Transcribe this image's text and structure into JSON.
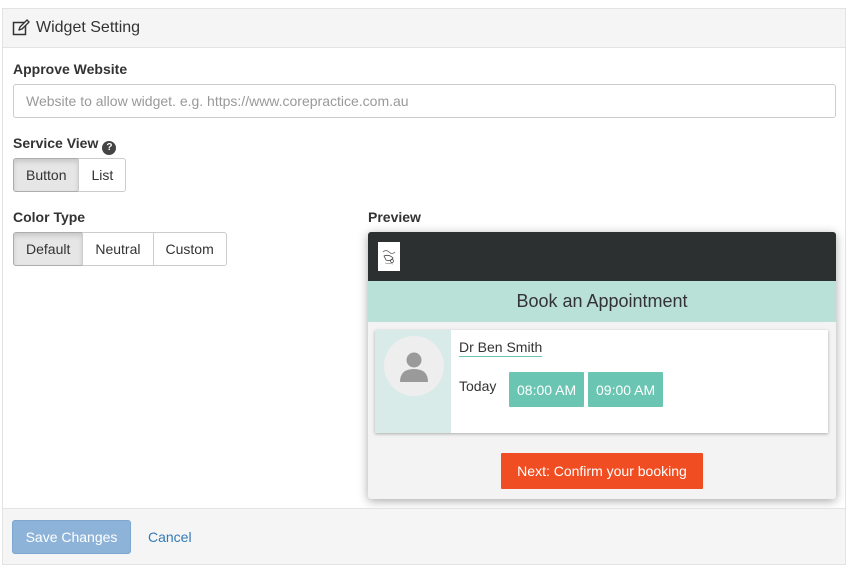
{
  "panel": {
    "title": "Widget Setting",
    "title_icon": "edit-icon"
  },
  "approve_website": {
    "label": "Approve Website",
    "placeholder": "Website to allow widget. e.g. https://www.corepractice.com.au",
    "value": ""
  },
  "service_view": {
    "label": "Service View",
    "help_icon": "question-circle-icon",
    "options": [
      "Button",
      "List"
    ],
    "selected": "Button"
  },
  "color_type": {
    "label": "Color Type",
    "options": [
      "Default",
      "Neutral",
      "Custom"
    ],
    "selected": "Default"
  },
  "preview": {
    "label": "Preview",
    "title": "Book an Appointment",
    "provider_name": "Dr Ben Smith",
    "day_label": "Today",
    "slots": [
      "08:00 AM",
      "09:00 AM"
    ],
    "next_button": "Next: Confirm your booking",
    "colors": {
      "header_bg": "#2c3031",
      "title_bg": "#b9e1d8",
      "slot_bg": "#6bc5b3",
      "next_bg": "#f04e22"
    }
  },
  "footer": {
    "save_label": "Save Changes",
    "cancel_label": "Cancel"
  }
}
